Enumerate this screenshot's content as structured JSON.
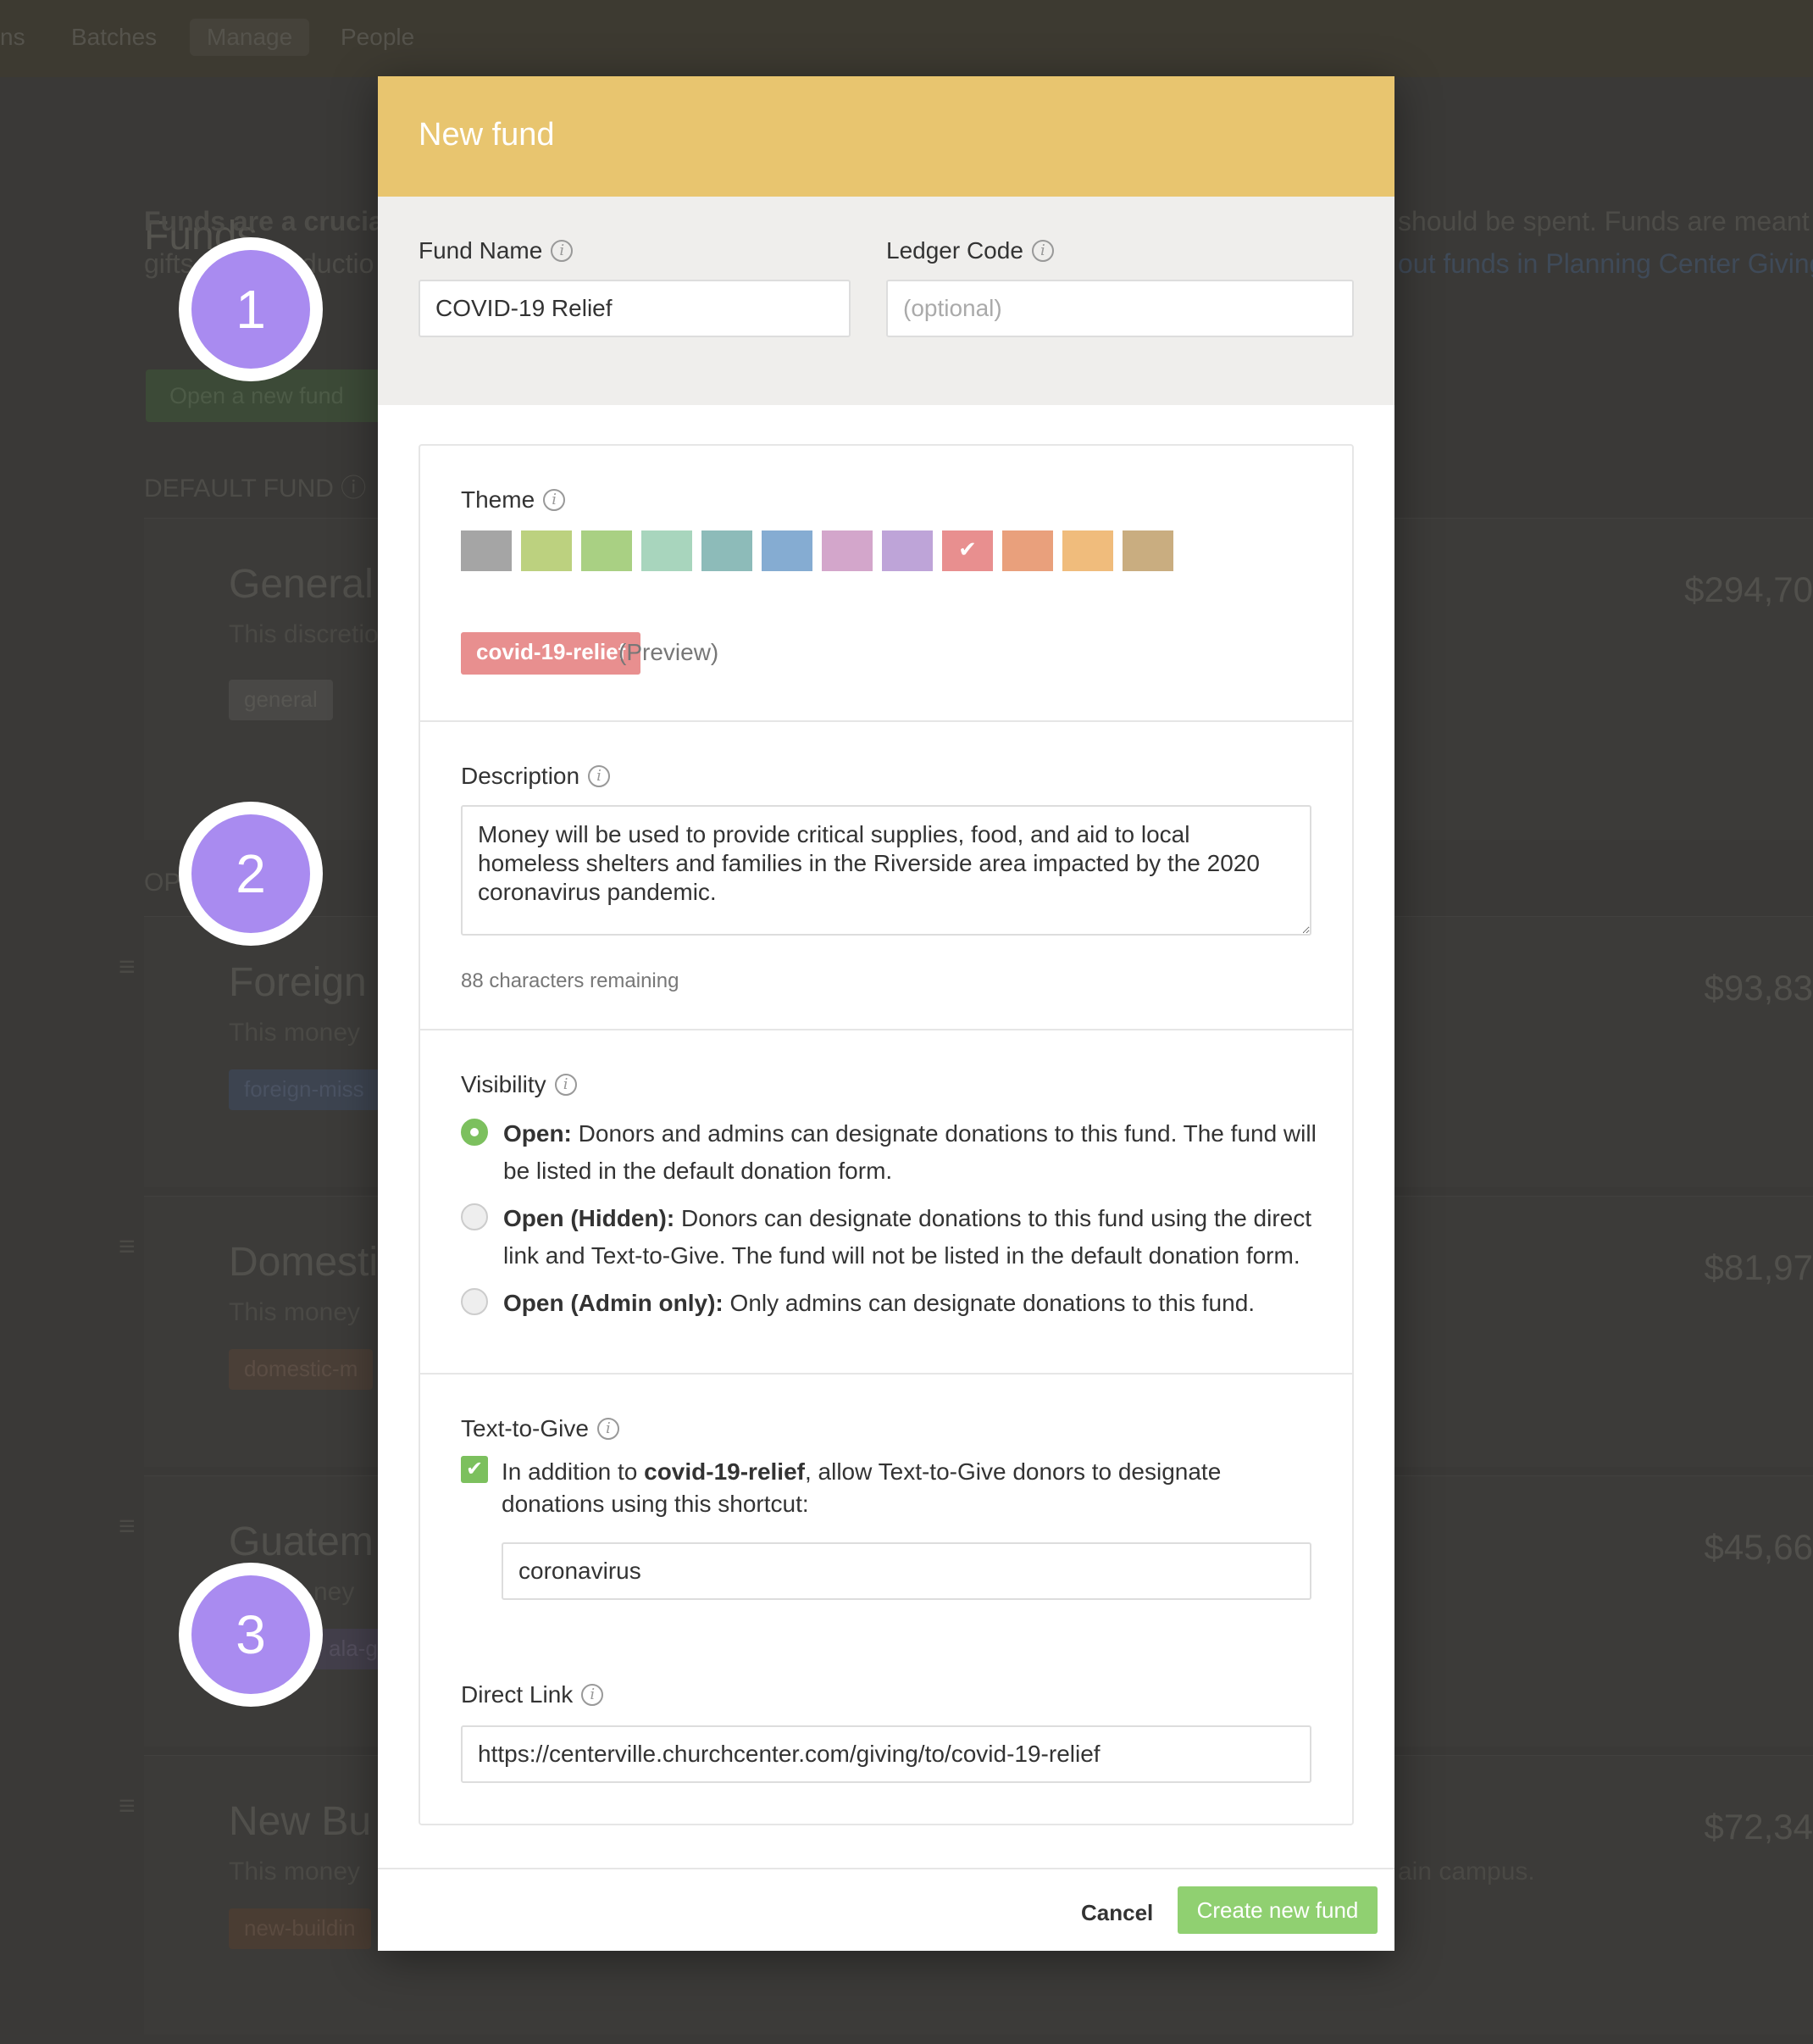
{
  "background": {
    "nav_tabs": [
      "ns",
      "Batches",
      "Manage",
      "People"
    ],
    "page_title": "Funds",
    "intro_line1_bold": "Funds are a crucial",
    "intro_line1_right": "should be spent. Funds are meant o",
    "intro_line2_left": "gifts",
    "intro_line2_mid": "ductio",
    "intro_line2_link": "out funds in Planning Center Giving.",
    "open_fund_button": "Open a new fund",
    "default_fund_label": "DEFAULT FUND",
    "open_label": "OP",
    "funds": [
      {
        "name": "General",
        "desc": "This discretio",
        "tag": "general",
        "amount": "$294,70"
      },
      {
        "name": "Foreign",
        "desc": "This money",
        "tag": "foreign-miss",
        "amount": "$93,83"
      },
      {
        "name": "Domesti",
        "desc": "This money",
        "tag": "domestic-m",
        "amount": "$81,97"
      },
      {
        "name": "Guatem",
        "desc": "ney",
        "tag": "ala-g",
        "amount": "$45,66"
      },
      {
        "name": "New Bu",
        "desc": "This money",
        "tag": "new-buildin",
        "amount": "$72,34",
        "desc_right": "ain campus."
      }
    ]
  },
  "markers": [
    "1",
    "2",
    "3"
  ],
  "modal": {
    "title": "New fund",
    "fund_name": {
      "label": "Fund Name",
      "value": "COVID-19 Relief"
    },
    "ledger_code": {
      "label": "Ledger Code",
      "placeholder": "(optional)"
    },
    "theme": {
      "label": "Theme",
      "swatches": [
        "#a5a5a5",
        "#bcd17f",
        "#a9d083",
        "#a8d5bd",
        "#8dbbb9",
        "#85acd2",
        "#d3a6cb",
        "#bea4d8",
        "#e88f8f",
        "#e9a07c",
        "#f0bc7c",
        "#c9ad80"
      ],
      "selected_index": 8,
      "tag_preview": "covid-19-relief",
      "preview_note": "(Preview)"
    },
    "description": {
      "label": "Description",
      "value": "Money will be used to provide critical supplies, food, and aid to local homeless shelters and families in the Riverside area impacted by the 2020 coronavirus pandemic.",
      "chars_remaining": "88 characters remaining"
    },
    "visibility": {
      "label": "Visibility",
      "options": [
        {
          "title": "Open:",
          "text": "Donors and admins can designate donations to this fund. The fund will be listed in the default donation form.",
          "checked": true
        },
        {
          "title": "Open (Hidden):",
          "text": "Donors can designate donations to this fund using the direct link and Text-to-Give. The fund will not be listed in the default donation form.",
          "checked": false
        },
        {
          "title": "Open (Admin only):",
          "text": "Only admins can designate donations to this fund.",
          "checked": false
        }
      ]
    },
    "text_to_give": {
      "label": "Text-to-Give",
      "check_pre": "In addition to",
      "check_bold": "covid-19-relief",
      "check_post": ", allow Text-to-Give donors to designate donations using this shortcut:",
      "shortcut": "coronavirus"
    },
    "direct_link": {
      "label": "Direct Link",
      "value": "https://centerville.churchcenter.com/giving/to/covid-19-relief"
    },
    "footer": {
      "cancel": "Cancel",
      "create": "Create new fund"
    }
  }
}
